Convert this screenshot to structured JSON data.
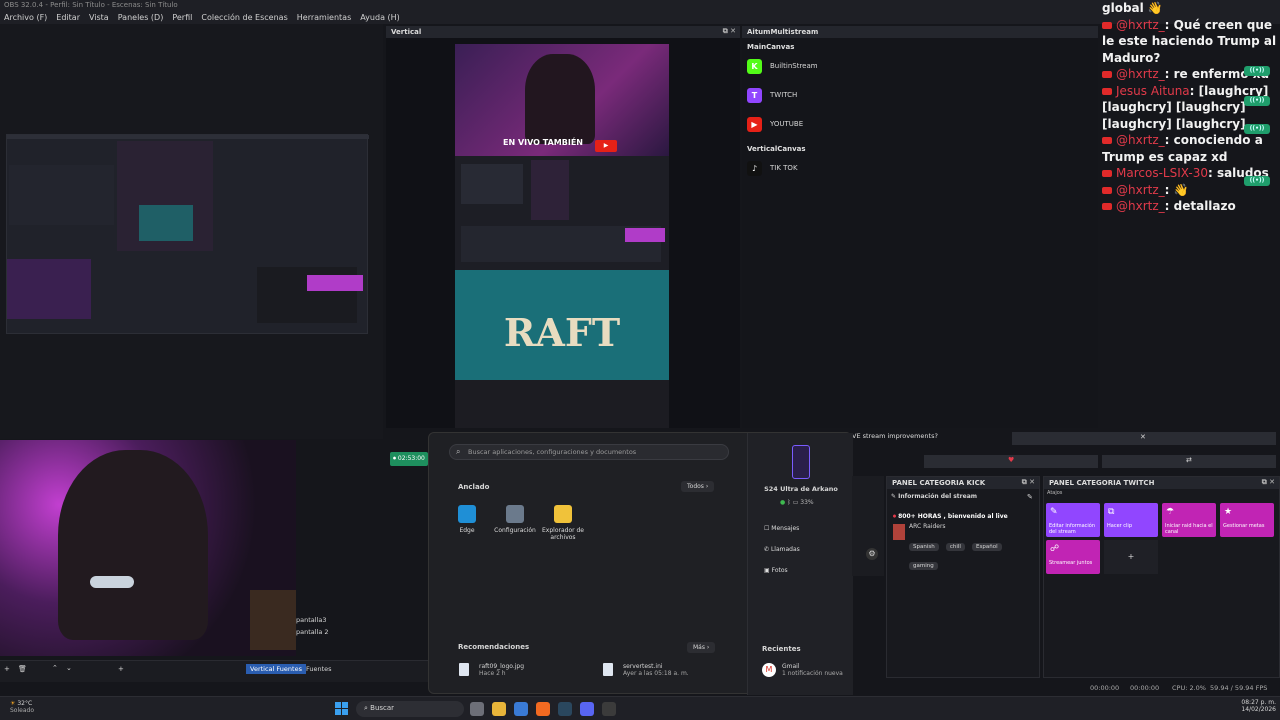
{
  "window": {
    "title": "OBS 32.0.4 - Perfil: Sin Título - Escenas: Sin Título"
  },
  "menu": [
    "Archivo (F)",
    "Editar",
    "Vista",
    "Paneles (D)",
    "Perfil",
    "Colección de Escenas",
    "Herramientas",
    "Ayuda (H)"
  ],
  "vertical": {
    "title": "Vertical",
    "stream_label": "EN VIVO TAMBIÉN",
    "game_logo": "RAFT"
  },
  "aitum": {
    "title": "AitumMultistream",
    "main_section": "MainCanvas",
    "main_outputs": [
      {
        "label": "BuiltinStream",
        "color": "#53fc18",
        "glyph": "K"
      },
      {
        "label": "TWITCH",
        "color": "#9146ff",
        "glyph": "T"
      },
      {
        "label": "YOUTUBE",
        "color": "#e62117",
        "glyph": "▶"
      }
    ],
    "vertical_section": "VerticalCanvas",
    "vertical_outputs": [
      {
        "label": "TIK TOK",
        "color": "#111111",
        "glyph": "♪"
      }
    ]
  },
  "chat": {
    "messages": [
      {
        "text": "global 👋"
      },
      {
        "user": "@hxrtz_",
        "text": ": Qué creen que le este haciendo Trump al Maduro?"
      },
      {
        "user": "@hxrtz_",
        "text": ": re enfermo xd"
      },
      {
        "user": "Jesus Aituna",
        "text": ": [laughcry][laughcry] [laughcry][laughcry] [laughcry]"
      },
      {
        "user": "@hxrtz_",
        "text": ": conociendo a Trump es capaz xd"
      },
      {
        "user": "Marcos-LSIX-30",
        "text": ": saludos"
      },
      {
        "user": "@hxrtz_",
        "text": ": 👋"
      },
      {
        "user": "@hxrtz_",
        "text": ": detallazo"
      }
    ]
  },
  "start_menu": {
    "search_placeholder": "Buscar aplicaciones, configuraciones y documentos",
    "pinned_label": "Anclado",
    "all_label": "Todos",
    "pinned": [
      {
        "label": "Edge",
        "color": "#1f8fd6"
      },
      {
        "label": "Configuración",
        "color": "#6b7a8c"
      },
      {
        "label": "Explorador de archivos",
        "color": "#f0c23a"
      }
    ],
    "recommended_label": "Recomendaciones",
    "more_label": "Más",
    "recommended": [
      {
        "name": "raft09_logo.jpg",
        "meta": "Hace 2 h"
      },
      {
        "name": "servertest.ini",
        "meta": "Ayer a las 05:18 a. m."
      }
    ],
    "phone": {
      "name": "S24 Ultra de Arkano",
      "battery": "33%",
      "links": [
        "Mensajes",
        "Llamadas",
        "Fotos"
      ],
      "recent_label": "Recientes",
      "recent": [
        {
          "app": "Gmail",
          "meta": "1 notificación nueva"
        }
      ]
    }
  },
  "stream_question": "VE stream improvements?",
  "panel_kick": {
    "title": "PANEL CATEGORIA KICK",
    "section": "Información del stream",
    "stream_title": "800+ HORAS , bienvenido al live",
    "category": "ARC Raiders",
    "tags": [
      "Spanish",
      "chill",
      "Español",
      "gaming"
    ]
  },
  "panel_twitch": {
    "title": "PANEL CATEGORIA TWITCH",
    "subtitle": "Atajos",
    "tiles": [
      {
        "label": "Editar información del stream",
        "icon": "✎",
        "color": "#9146ff"
      },
      {
        "label": "Hacer clip",
        "icon": "⧉",
        "color": "#9146ff"
      },
      {
        "label": "Iniciar raid hacia el canal",
        "icon": "☂",
        "color": "#c124b4"
      },
      {
        "label": "Gestionar metas",
        "icon": "★",
        "color": "#c124b4"
      },
      {
        "label": "Streamear juntos",
        "icon": "☍",
        "color": "#c124b4"
      }
    ]
  },
  "scenes": {
    "items": [
      "pantalla3",
      "pantalla 2"
    ],
    "tabs": [
      "Vertical Fuentes",
      "Fuentes"
    ]
  },
  "status": {
    "rec_time": "00:00:00",
    "stream_time": "00:00:00",
    "cpu": "CPU: 2.0%",
    "fps": "59.94 / 59.94 FPS",
    "live_time": "02:53:00"
  },
  "taskbar": {
    "weather_temp": "32°C",
    "weather_text": "Soleado",
    "search": "Buscar",
    "clock_time": "08:27 p. m.",
    "clock_date": "14/02/2026",
    "icons": [
      {
        "name": "task-view",
        "color": "#6d6f78"
      },
      {
        "name": "file-explorer",
        "color": "#e8b53a"
      },
      {
        "name": "store",
        "color": "#3a7bd5"
      },
      {
        "name": "brave",
        "color": "#f26a21"
      },
      {
        "name": "steam",
        "color": "#2a475e"
      },
      {
        "name": "discord",
        "color": "#5865f2"
      },
      {
        "name": "obs",
        "color": "#3b3b3b"
      }
    ]
  }
}
